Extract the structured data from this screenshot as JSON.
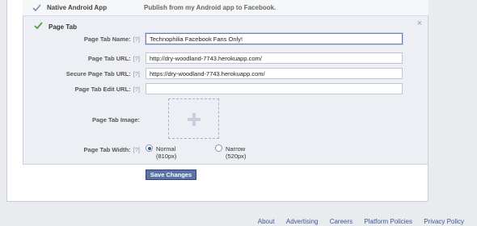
{
  "android": {
    "title": "Native Android App",
    "description": "Publish from my Android app to Facebook."
  },
  "page_tab": {
    "section_title": "Page Tab",
    "close": "×",
    "help_marker": "[?]",
    "name_label": "Page Tab Name:",
    "name_value": "Technophilia Facebook Fans Only!",
    "url_label": "Page Tab URL:",
    "url_value": "http://dry-woodland-7743.herokuapp.com/",
    "secure_url_label": "Secure Page Tab URL:",
    "secure_url_value": "https://dry-woodland-7743.herokuapp.com/",
    "edit_url_label": "Page Tab Edit URL:",
    "edit_url_value": "",
    "image_label": "Page Tab Image:",
    "width_label": "Page Tab Width:",
    "width_options": [
      {
        "label": "Normal (810px)",
        "checked": true
      },
      {
        "label": "Narrow (520px)",
        "checked": false
      }
    ]
  },
  "save_button": "Save Changes",
  "footer_links": [
    "About",
    "Advertising",
    "Careers",
    "Platform Policies",
    "Privacy Policy"
  ],
  "colors": {
    "accent": "#3b5998",
    "button": "#5b74a8",
    "check": "#5a9e4b"
  }
}
